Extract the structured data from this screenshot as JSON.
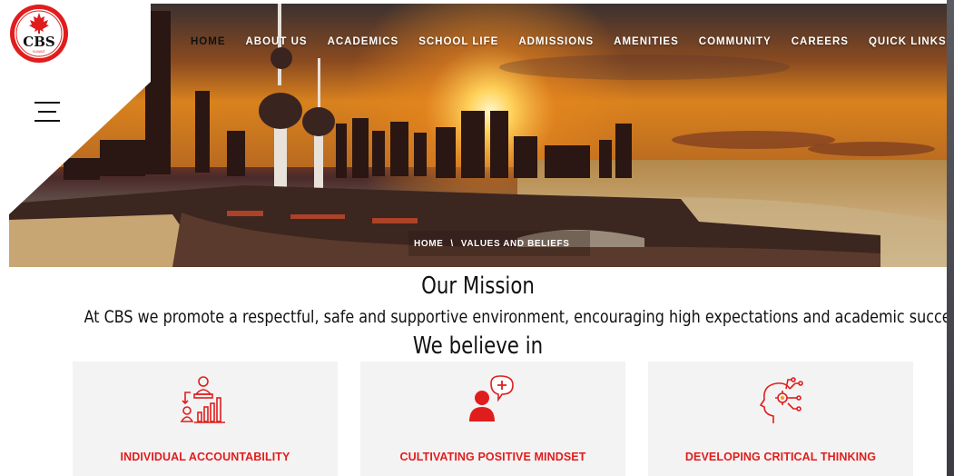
{
  "brand": {
    "logo_text": "CBS",
    "logo_subtext": "KUWAIT",
    "accent": "#e01d1d"
  },
  "nav": {
    "items": [
      {
        "label": "HOME",
        "active": true
      },
      {
        "label": "ABOUT US"
      },
      {
        "label": "ACADEMICS"
      },
      {
        "label": "SCHOOL LIFE"
      },
      {
        "label": "ADMISSIONS"
      },
      {
        "label": "AMENITIES"
      },
      {
        "label": "COMMUNITY"
      },
      {
        "label": "CAREERS"
      },
      {
        "label": "QUICK LINKS"
      }
    ]
  },
  "breadcrumb": {
    "home": "HOME",
    "separator": "\\",
    "current": "VALUES AND BELIEFS"
  },
  "mission": {
    "title": "Our Mission",
    "text": "At CBS we promote a respectful, safe and supportive environment, encouraging high expectations and academic success."
  },
  "beliefs": {
    "title": "We believe in",
    "cards": [
      {
        "label": "INDIVIDUAL ACCOUNTABILITY",
        "icon": "accountability-icon"
      },
      {
        "label": "CULTIVATING POSITIVE MINDSET",
        "icon": "positive-mindset-icon"
      },
      {
        "label": "DEVELOPING CRITICAL THINKING",
        "icon": "critical-thinking-icon"
      }
    ]
  }
}
